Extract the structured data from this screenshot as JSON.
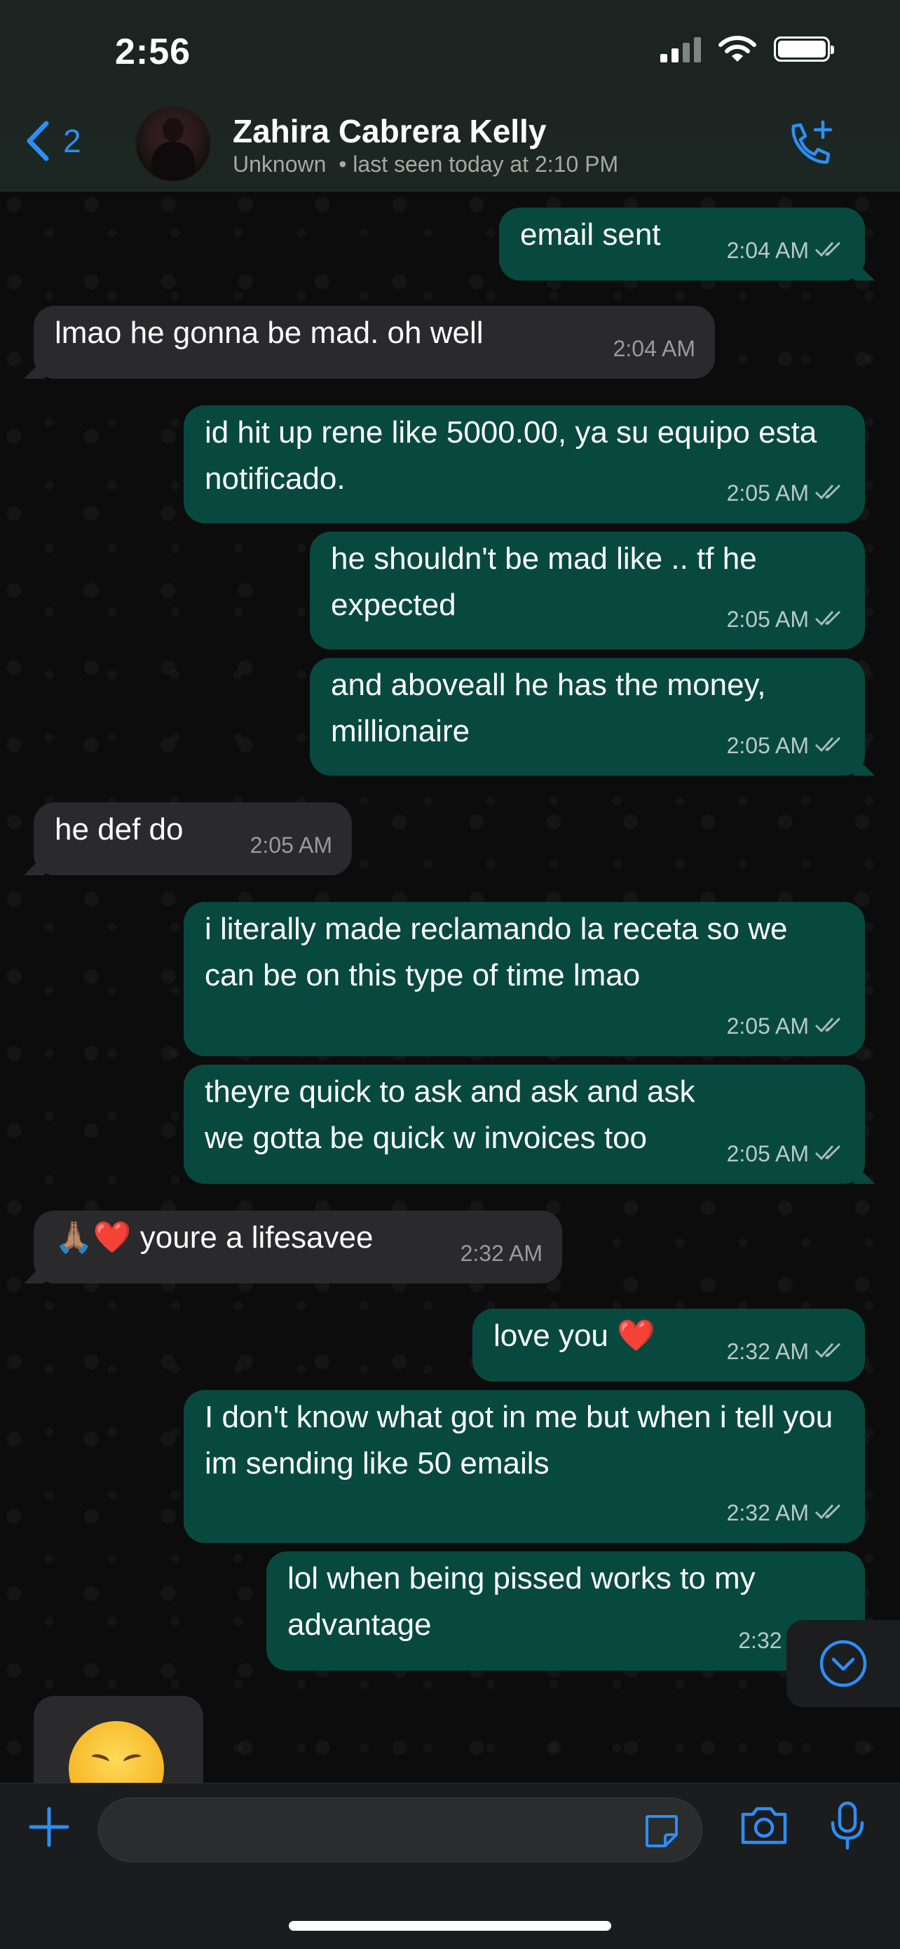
{
  "status_bar": {
    "time": "2:56"
  },
  "header": {
    "back_count": "2",
    "contact_name": "Zahira Cabrera Kelly",
    "contact_status": "Unknown  • last seen today at 2:10 PM",
    "icons": {
      "back": "chevron-left-icon",
      "call": "add-call-icon"
    }
  },
  "messages": [
    {
      "dir": "out",
      "text": "email sent",
      "time": "2:04 AM"
    },
    {
      "dir": "in",
      "text": "lmao he gonna be mad. oh well",
      "time": "2:04 AM"
    },
    {
      "dir": "out",
      "text": "id hit up rene like 5000.00, ya su equipo esta notificado.",
      "time": "2:05 AM"
    },
    {
      "dir": "out",
      "text": "he shouldn't be mad like .. tf he expected",
      "time": "2:05 AM"
    },
    {
      "dir": "out",
      "text": "and aboveall he has the money, millionaire",
      "time": "2:05 AM"
    },
    {
      "dir": "in",
      "text": "he def do",
      "time": "2:05 AM"
    },
    {
      "dir": "out",
      "text": "i literally made reclamando la receta so we can be on this type of time lmao",
      "time": "2:05 AM"
    },
    {
      "dir": "out",
      "text": "theyre quick to ask and ask and ask we gotta be quick w invoices too",
      "time": "2:05 AM"
    },
    {
      "dir": "in",
      "text": "🙏🏽❤️ youre a lifesavee",
      "time": "2:32 AM"
    },
    {
      "dir": "out",
      "text": "love you ❤️",
      "time": "2:32 AM"
    },
    {
      "dir": "out",
      "text": "I don't know what got in me but when i tell you im sending like 50 emails",
      "time": "2:32 AM"
    },
    {
      "dir": "out",
      "text": "lol when being pissed works to my advantage",
      "time": "2:32 A"
    }
  ],
  "partial_message": {
    "emoji": "weary-face-emoji"
  },
  "colors": {
    "accent": "#2d8ef5",
    "outgoing_bubble": "#07493f",
    "incoming_bubble": "#2a2a2c",
    "background": "#0c0c0c"
  },
  "input_bar": {
    "placeholder": "",
    "icons": [
      "plus-icon",
      "sticker-icon",
      "camera-icon",
      "microphone-icon"
    ]
  }
}
